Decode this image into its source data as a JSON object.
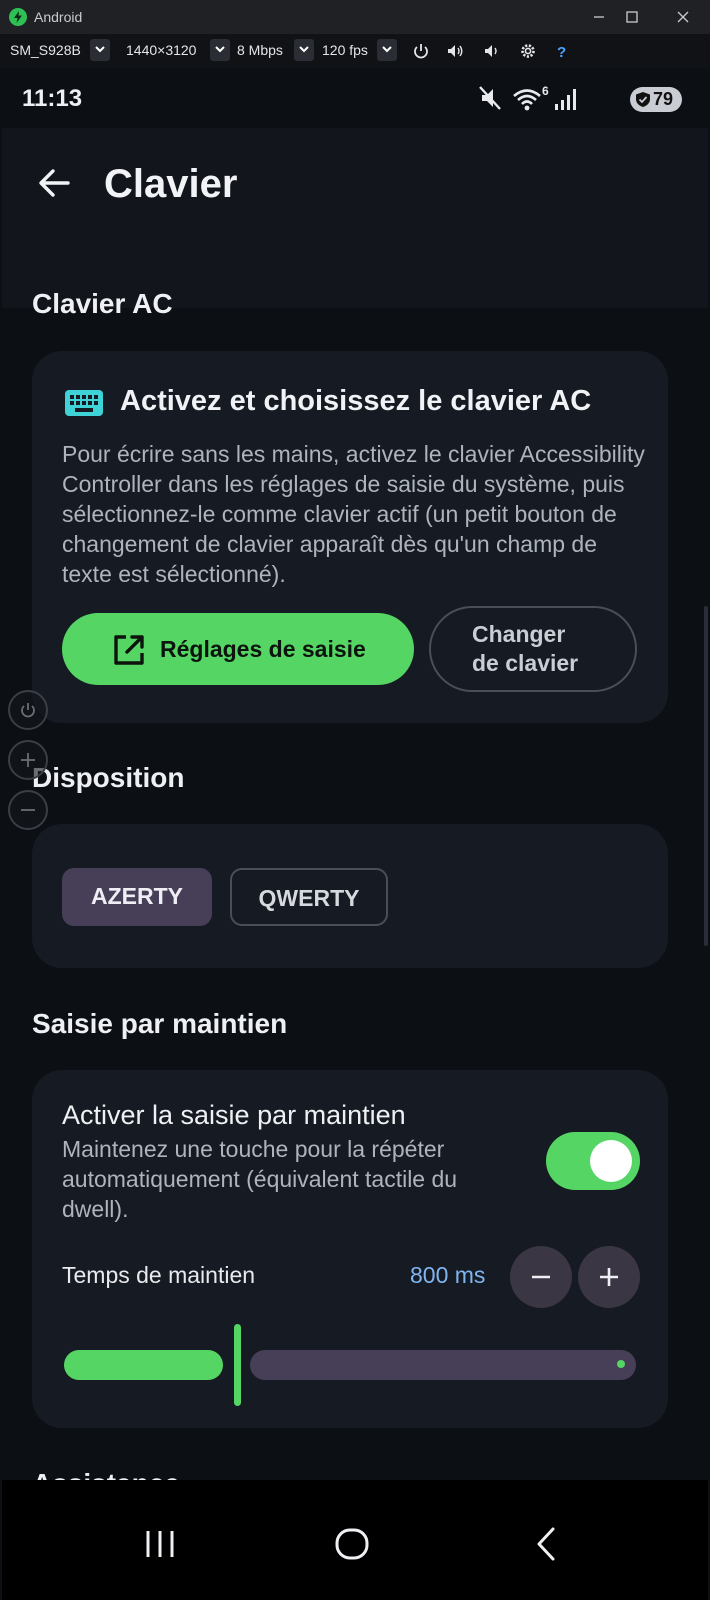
{
  "window": {
    "title": "Android"
  },
  "toolbar": {
    "device": "SM_S928B",
    "resolution": "1440×3120",
    "bitrate": "8 Mbps",
    "fps": "120 fps"
  },
  "status_bar": {
    "time": "11:13",
    "wifi_badge": "6",
    "battery": "79"
  },
  "app_bar": {
    "title": "Clavier"
  },
  "sections": {
    "keyboard": {
      "title": "Clavier AC",
      "card_title": "Activez et choisissez le clavier AC",
      "description": "Pour écrire sans les mains, activez le clavier Accessibility Controller dans les réglages de saisie du système, puis sélectionnez-le comme clavier actif (un petit bouton de changement de clavier apparaît dès qu'un champ de texte est sélectionné).",
      "primary_button": "Réglages de saisie",
      "secondary_button_line1": "Changer",
      "secondary_button_line2": "de clavier"
    },
    "layout": {
      "title": "Disposition",
      "options": [
        "AZERTY",
        "QWERTY"
      ],
      "selected": "AZERTY"
    },
    "hold": {
      "title": "Saisie par maintien",
      "setting_title": "Activer la saisie par maintien",
      "setting_desc": "Maintenez une touche pour la répéter automatiquement (équivalent tactile du dwell).",
      "enabled": true,
      "duration_label": "Temps de maintien",
      "duration_value": "800 ms",
      "slider_fraction": 0.3
    },
    "next": {
      "title": "Assistance"
    }
  },
  "colors": {
    "accent": "#55d664",
    "card": "#161a22",
    "chip_selected": "#463f57",
    "value_text": "#7fb6f0"
  }
}
